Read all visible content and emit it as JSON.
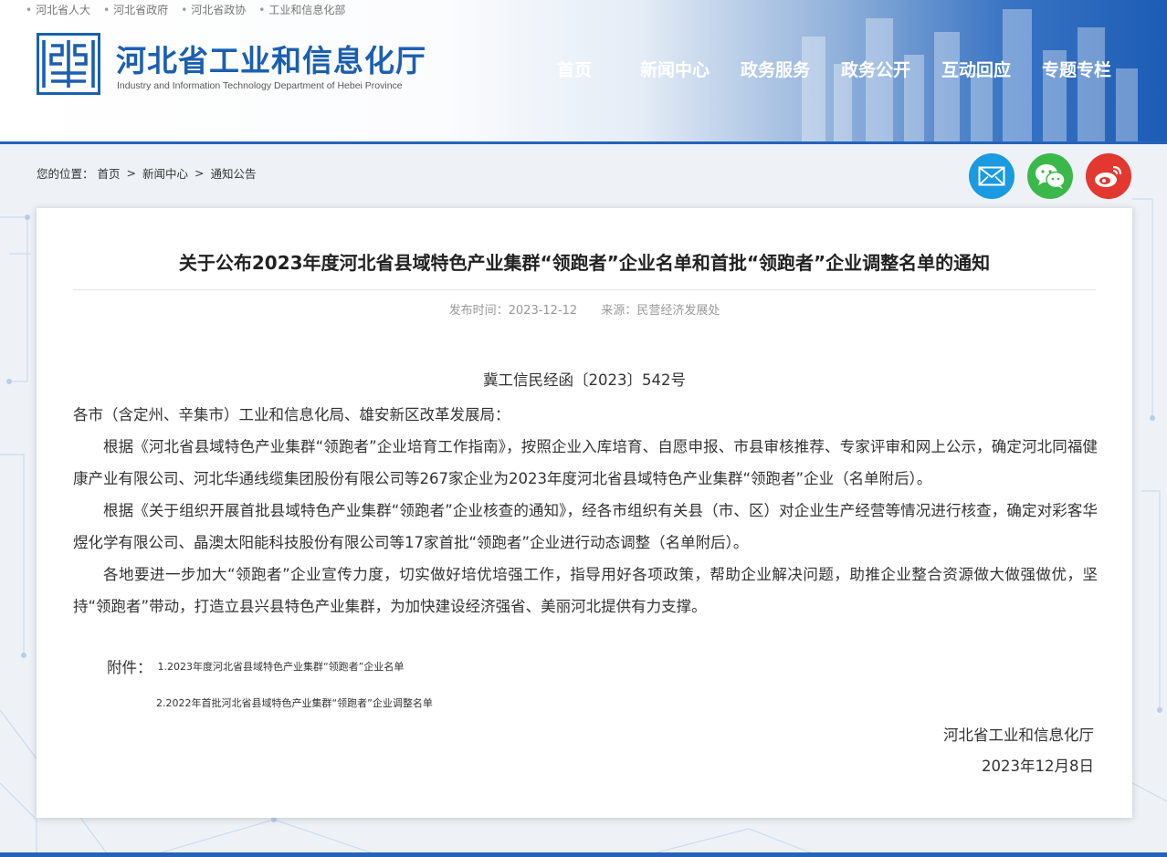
{
  "top_links": [
    "河北省人大",
    "河北省政府",
    "河北省政协",
    "工业和信息化部"
  ],
  "site": {
    "title": "河北省工业和信息化厅",
    "subtitle": "Industry and Information Technology Department of Hebei Province"
  },
  "nav": [
    "首页",
    "新闻中心",
    "政务服务",
    "政务公开",
    "互动回应",
    "专题专栏"
  ],
  "breadcrumb": {
    "label": "您的位置：",
    "items": [
      "首页",
      "新闻中心",
      "通知公告"
    ],
    "separator": ">"
  },
  "share_icons": [
    "mail-icon",
    "wechat-icon",
    "weibo-icon"
  ],
  "article": {
    "title": "关于公布2023年度河北省县域特色产业集群“领跑者”企业名单和首批“领跑者”企业调整名单的通知",
    "publish_time": "发布时间：2023-12-12",
    "source": "来源：民营经济发展处",
    "doc_number": "冀工信民经函〔2023〕542号",
    "salutation": "各市（含定州、辛集市）工业和信息化局、雄安新区改革发展局：",
    "paragraphs": [
      "根据《河北省县域特色产业集群“领跑者”企业培育工作指南》，按照企业入库培育、自愿申报、市县审核推荐、专家评审和网上公示，确定河北同福健康产业有限公司、河北华通线缆集团股份有限公司等267家企业为2023年度河北省县域特色产业集群“领跑者”企业（名单附后）。",
      "根据《关于组织开展首批县域特色产业集群“领跑者”企业核查的通知》，经各市组织有关县（市、区）对企业生产经营等情况进行核查，确定对彩客华煜化学有限公司、晶澳太阳能科技股份有限公司等17家首批“领跑者”企业进行动态调整（名单附后）。",
      "各地要进一步加大“领跑者”企业宣传力度，切实做好培优培强工作，指导用好各项政策，帮助企业解决问题，助推企业整合资源做大做强做优，坚持“领跑者”带动，打造立县兴县特色产业集群，为加快建设经济强省、美丽河北提供有力支撑。"
    ],
    "attachments_label": "附件：",
    "attachments": [
      "1.2023年度河北省县域特色产业集群“领跑者”企业名单",
      "2.2022年首批河北省县域特色产业集群“领跑者”企业调整名单"
    ],
    "signature_org": "河北省工业和信息化厅",
    "signature_date": "2023年12月8日"
  },
  "colors": {
    "brand_blue": "#1b5fb0",
    "header_gradient_end": "#1c5cb5",
    "mail": "#1a9ae0",
    "wechat": "#3bb84a",
    "weibo": "#e3382f"
  }
}
